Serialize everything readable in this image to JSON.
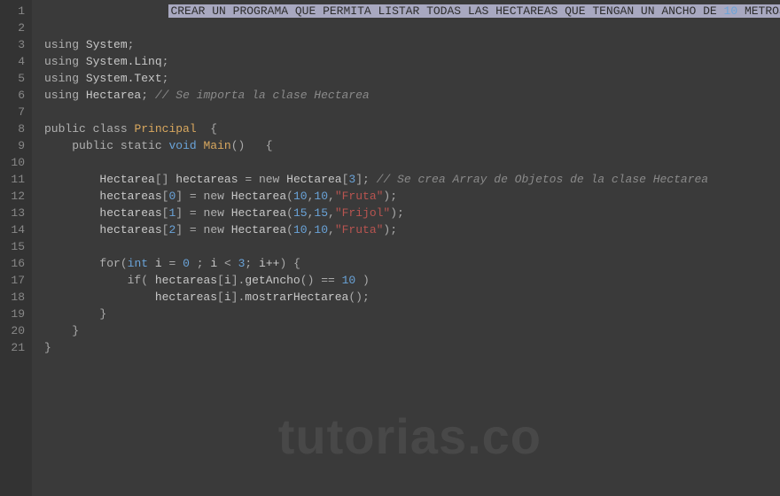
{
  "watermark": "tutorias.co",
  "lineNumbers": [
    "1",
    "2",
    "3",
    "4",
    "5",
    "6",
    "7",
    "8",
    "9",
    "10",
    "11",
    "12",
    "13",
    "14",
    "15",
    "16",
    "17",
    "18",
    "19",
    "20",
    "21"
  ],
  "line1_highlight_text": "CREAR UN PROGRAMA QUE PERMITA LISTAR TODAS LAS HECTAREAS QUE TENGAN UN ANCHO DE ",
  "line1_highlight_num": "10",
  "line1_highlight_text2": " METROS",
  "tokens": {
    "using": "using",
    "System": "System",
    "SystemLinq": "System.Linq",
    "SystemText": "System.Text",
    "Hectarea": "Hectarea",
    "comment_import": "// Se importa la clase Hectarea",
    "public": "public",
    "class": "class",
    "Principal": "Principal",
    "static": "static",
    "void": "void",
    "Main": "Main",
    "hectareas": "hectareas",
    "new": "new",
    "comment_array": "// Se crea Array de Objetos de la clase Hectarea",
    "n3": "3",
    "n0": "0",
    "n1": "1",
    "n2": "2",
    "n10": "10",
    "n15": "15",
    "sFruta": "\"Fruta\"",
    "sFrijol": "\"Frijol\"",
    "for": "for",
    "int": "int",
    "i": "i",
    "if": "if",
    "getAncho": "getAncho",
    "mostrarHectarea": "mostrarHectarea",
    "eq": "==",
    "semi": ";",
    "comma": ",",
    "dot": ".",
    "lbrace": "{",
    "rbrace": "}",
    "lparen": "(",
    "rparen": ")",
    "lbrack": "[",
    "rbrack": "]",
    "assign": "=",
    "lt": "<",
    "incr": "i++",
    "space": " "
  }
}
